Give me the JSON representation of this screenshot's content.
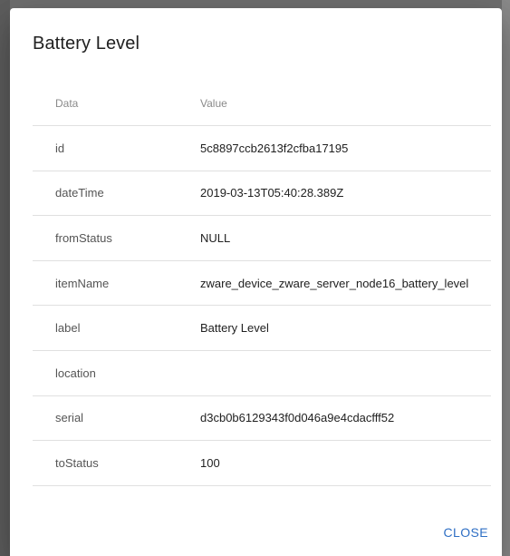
{
  "dialog": {
    "title": "Battery Level",
    "close_label": "CLOSE"
  },
  "table": {
    "headers": [
      "Data",
      "Value"
    ],
    "rows": [
      {
        "key": "id",
        "value": "5c8897ccb2613f2cfba17195"
      },
      {
        "key": "dateTime",
        "value": "2019-03-13T05:40:28.389Z"
      },
      {
        "key": "fromStatus",
        "value": "NULL"
      },
      {
        "key": "itemName",
        "value": "zware_device_zware_server_node16_battery_level"
      },
      {
        "key": "label",
        "value": "Battery Level"
      },
      {
        "key": "location",
        "value": ""
      },
      {
        "key": "serial",
        "value": "d3cb0b6129343f0d046a9e4cdacfff52"
      },
      {
        "key": "toStatus",
        "value": "100"
      }
    ]
  },
  "colors": {
    "accent": "#2f6fc4",
    "backdrop": "#6f6f6f"
  }
}
